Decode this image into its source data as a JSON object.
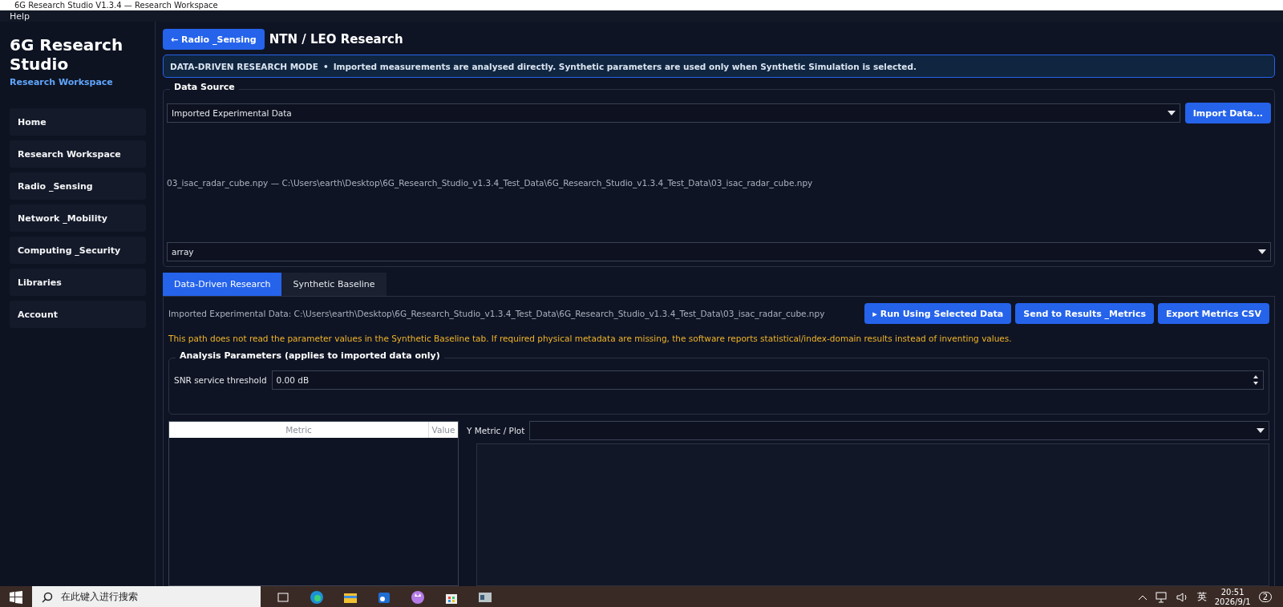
{
  "window": {
    "title": "6G Research Studio V1.3.4 — Research Workspace"
  },
  "menu": [
    "Help"
  ],
  "sidebar": {
    "title": "6G Research Studio",
    "subtitle": "Research Workspace",
    "items": [
      {
        "label": "Home",
        "selected": false
      },
      {
        "label": "Research Workspace",
        "selected": false
      },
      {
        "label": "Radio _Sensing",
        "selected": false
      },
      {
        "label": "Network _Mobility",
        "selected": false
      },
      {
        "label": "Computing _Security",
        "selected": false
      },
      {
        "label": "Libraries",
        "selected": false
      },
      {
        "label": "Account",
        "selected": false
      }
    ]
  },
  "header": {
    "back_button": "← Radio _Sensing",
    "title": "NTN / LEO Research"
  },
  "banner": {
    "mode": "DATA-DRIVEN RESEARCH MODE",
    "separator": "•",
    "message": "Imported measurements are analysed directly. Synthetic parameters are used only when Synthetic Simulation is selected."
  },
  "data_source": {
    "label": "Data Source",
    "source_value": "Imported Experimental Data",
    "import_button": "Import Data...",
    "file_info": "03_isac_radar_cube.npy — C:\\Users\\earth\\Desktop\\6G_Research_Studio_v1.3.4_Test_Data\\6G_Research_Studio_v1.3.4_Test_Data\\03_isac_radar_cube.npy",
    "variable_value": "array"
  },
  "tabs": [
    {
      "label": "Data-Driven Research",
      "selected": true
    },
    {
      "label": "Synthetic Baseline",
      "selected": false
    }
  ],
  "panel": {
    "data_path": "Imported Experimental Data: C:\\Users\\earth\\Desktop\\6G_Research_Studio_v1.3.4_Test_Data\\6G_Research_Studio_v1.3.4_Test_Data\\03_isac_radar_cube.npy",
    "buttons": [
      "▸ Run Using Selected Data",
      "Send to Results _Metrics",
      "Export Metrics CSV"
    ],
    "warning": "This path does not read the parameter values in the Synthetic Baseline tab. If required physical metadata are missing, the software reports statistical/index-domain results instead of inventing values.",
    "analysis": {
      "label": "Analysis Parameters (applies to imported data only)",
      "snr_label": "SNR service threshold",
      "snr_value": "0.00 dB"
    },
    "table": {
      "columns": [
        "Metric",
        "Value"
      ]
    },
    "plot": {
      "label": "Y Metric / Plot"
    }
  },
  "taskbar": {
    "search_placeholder": "在此键入进行搜索",
    "ime": "英",
    "time": "20:51",
    "date": "2026/9/1",
    "notifications": "2"
  }
}
